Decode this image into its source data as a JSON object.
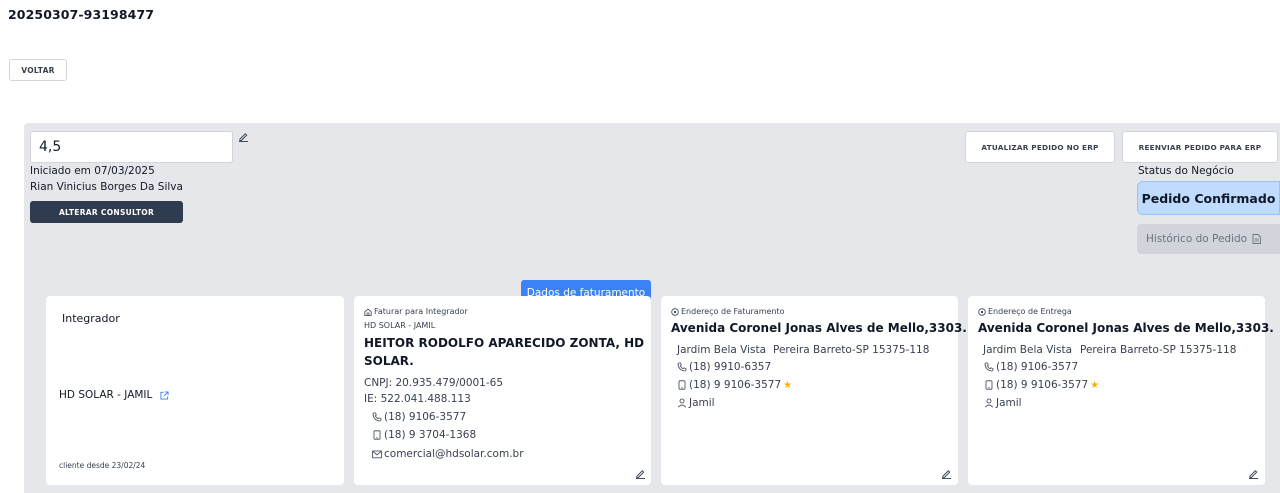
{
  "header": {
    "order_id": "20250307-93198477",
    "back_label": "VOLTAR"
  },
  "summary": {
    "score_value": "4,5",
    "started": "Iniciado em 07/03/2025",
    "consultant": "Rian Vinicius Borges Da Silva",
    "change_consultant_label": "ALTERAR CONSULTOR"
  },
  "actions": {
    "update_erp_label": "ATUALIZAR PEDIDO NO ERP",
    "resend_erp_label": "REENVIAR PEDIDO PARA ERP"
  },
  "status": {
    "label": "Status do Negócio",
    "value": "Pedido Confirmado",
    "history_label": "Histórico do Pedido"
  },
  "integrator_card": {
    "title": "Integrador",
    "name": "HD SOLAR - JAMIL",
    "client_since": "cliente desde 23/02/24"
  },
  "billing_tag": "Dados de faturamento",
  "billing_card": {
    "label": "Faturar para Integrador",
    "company_short": "HD SOLAR - JAMIL",
    "company_name_line1": "HEITOR RODOLFO APARECIDO ZONTA, HD",
    "company_name_line2": "SOLAR.",
    "cnpj": "CNPJ: 20.935.479/0001-65",
    "ie": "IE: 522.041.488.113",
    "phone": "(18) 9106-3577",
    "mobile": "(18) 9 3704-1368",
    "email": "comercial@hdsolar.com.br"
  },
  "billing_address_card": {
    "label": "Endereço de Faturamento",
    "street": "Avenida Coronel Jonas Alves de Mello,3303.",
    "district": "Jardim Bela Vista",
    "city": "Pereira Barreto-SP 15375-118",
    "phone": "(18) 9910-6357",
    "mobile": "(18) 9 9106-3577",
    "contact": "Jamil"
  },
  "delivery_address_card": {
    "label": "Endereço de Entrega",
    "street": "Avenida Coronel Jonas Alves de Mello,3303.",
    "district": "Jardim Bela Vista",
    "city": "Pereira Barreto-SP 15375-118",
    "phone": "(18) 9106-3577",
    "mobile": "(18) 9 9106-3577",
    "contact": "Jamil"
  },
  "colors": {
    "accent": "#3b82f6",
    "dark_button": "#2f3b4e",
    "status_bg": "#bfdbfe",
    "star": "#f5b400",
    "panel_bg": "#e5e7eb"
  },
  "icons": {
    "edit": "pencil-icon",
    "external": "external-link-icon",
    "home": "home-icon",
    "location": "location-pin-icon",
    "phone": "phone-icon",
    "mobile": "mobile-icon",
    "mail": "mail-icon",
    "user": "user-icon",
    "star": "star-icon",
    "document": "document-icon"
  }
}
